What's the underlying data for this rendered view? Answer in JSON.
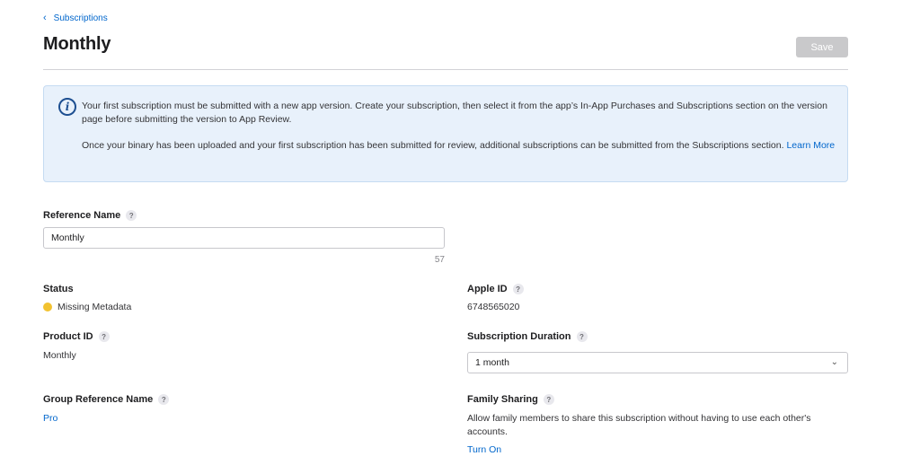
{
  "header": {
    "back_label": "Subscriptions",
    "title": "Monthly",
    "save_label": "Save"
  },
  "notice": {
    "paragraph1": "Your first subscription must be submitted with a new app version. Create your subscription, then select it from the app’s In-App Purchases and Subscriptions section on the version page before submitting the version to App Review.",
    "paragraph2_text": "Once your binary has been uploaded and your first subscription has been submitted for review, additional subscriptions can be submitted from the Subscriptions section. ",
    "learn_more": "Learn More"
  },
  "reference_name": {
    "label": "Reference Name",
    "value": "Monthly",
    "remaining": "57"
  },
  "status": {
    "label": "Status",
    "value": "Missing Metadata",
    "color": "#f2c230"
  },
  "apple_id": {
    "label": "Apple ID",
    "value": "6748565020"
  },
  "product_id": {
    "label": "Product ID",
    "value": "Monthly"
  },
  "subscription_duration": {
    "label": "Subscription Duration",
    "selected": "1 month"
  },
  "group_reference_name": {
    "label": "Group Reference Name",
    "value": "Pro"
  },
  "family_sharing": {
    "label": "Family Sharing",
    "description": "Allow family members to share this subscription without having to use each other's accounts.",
    "action": "Turn On"
  },
  "help_glyph": "?"
}
